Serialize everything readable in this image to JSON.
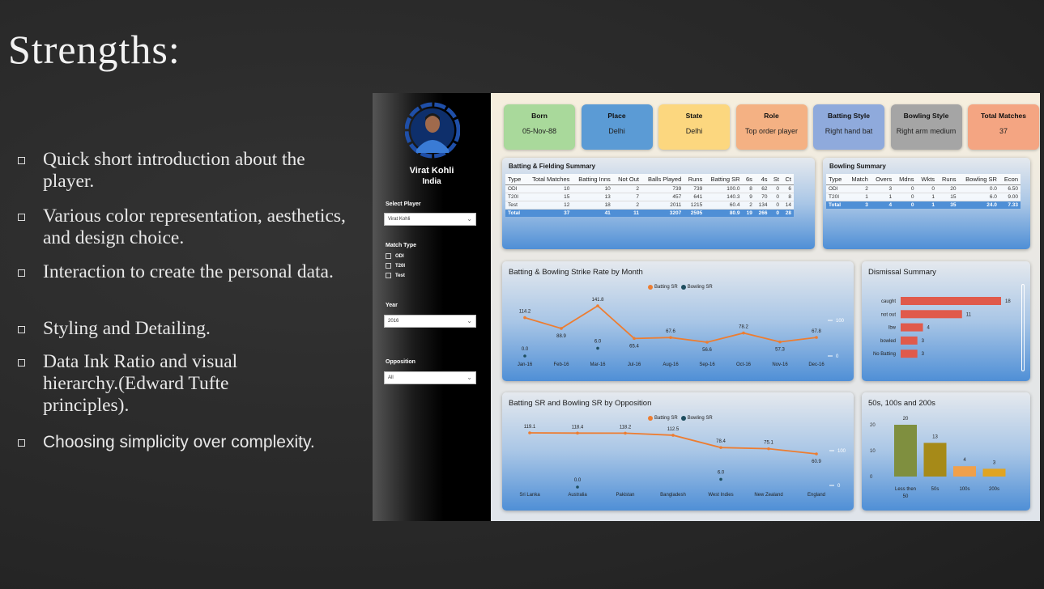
{
  "slide": {
    "title": "Strengths:",
    "bullets": [
      "Quick short introduction about the player.",
      "Various color representation, aesthetics, and design choice.",
      "Interaction to create the personal data.",
      "Styling and Detailing.",
      "Data Ink Ratio and visual hierarchy.(Edward Tufte principles).",
      "Choosing simplicity over complexity."
    ]
  },
  "sidebar": {
    "player_name": "Virat Kohli",
    "country": "India",
    "select_player_label": "Select Player",
    "select_player_value": "Virat Kohli",
    "match_type_label": "Match Type",
    "match_types": [
      "ODI",
      "T20I",
      "Test"
    ],
    "year_label": "Year",
    "year_value": "2016",
    "opposition_label": "Opposition",
    "opposition_value": "All"
  },
  "cards": [
    {
      "title": "Born",
      "value": "05-Nov-88",
      "color": "#a9d99b"
    },
    {
      "title": "Place",
      "value": "Delhi",
      "color": "#5b9bd5"
    },
    {
      "title": "State",
      "value": "Delhi",
      "color": "#fcd77f"
    },
    {
      "title": "Role",
      "value": "Top order player",
      "color": "#f4b183"
    },
    {
      "title": "Batting Style",
      "value": "Right hand bat",
      "color": "#8faadc"
    },
    {
      "title": "Bowling Style",
      "value": "Right arm medium",
      "color": "#a5a5a5"
    },
    {
      "title": "Total Matches",
      "value": "37",
      "color": "#f4a582"
    }
  ],
  "batting_summary": {
    "title": "Batting & Fielding Summary",
    "headers": [
      "Type",
      "Total Matches",
      "Batting Inns",
      "Not Out",
      "Balls Played",
      "Runs",
      "Batting SR",
      "6s",
      "4s",
      "St",
      "Ct"
    ],
    "rows": [
      [
        "ODI",
        "10",
        "10",
        "2",
        "739",
        "739",
        "100.0",
        "8",
        "62",
        "0",
        "6"
      ],
      [
        "T20I",
        "15",
        "13",
        "7",
        "457",
        "641",
        "140.3",
        "9",
        "70",
        "0",
        "8"
      ],
      [
        "Test",
        "12",
        "18",
        "2",
        "2011",
        "1215",
        "60.4",
        "2",
        "134",
        "0",
        "14"
      ]
    ],
    "total": [
      "Total",
      "37",
      "41",
      "11",
      "3207",
      "2595",
      "80.9",
      "19",
      "266",
      "0",
      "28"
    ]
  },
  "bowling_summary": {
    "title": "Bowling Summary",
    "headers": [
      "Type",
      "Match",
      "Overs",
      "Mdns",
      "Wkts",
      "Runs",
      "Bowling SR",
      "Econ"
    ],
    "rows": [
      [
        "ODI",
        "2",
        "3",
        "0",
        "0",
        "20",
        "0.0",
        "6.50"
      ],
      [
        "T20I",
        "1",
        "1",
        "0",
        "1",
        "15",
        "6.0",
        "9.00"
      ]
    ],
    "total": [
      "Total",
      "3",
      "4",
      "0",
      "1",
      "35",
      "24.0",
      "7.33"
    ]
  },
  "legend": {
    "batting": "Batting SR",
    "bowling": "Bowling SR",
    "batting_color": "#ed7d31",
    "bowling_color": "#1f4e5f"
  },
  "chart_data": [
    {
      "type": "line",
      "title": "Batting & Bowling Strike Rate by Month",
      "categories": [
        "Jan-16",
        "Feb-16",
        "Mar-16",
        "Jul-16",
        "Aug-16",
        "Sep-16",
        "Oct-16",
        "Nov-16",
        "Dec-16"
      ],
      "series": [
        {
          "name": "Batting SR",
          "values": [
            114.2,
            88.9,
            141.8,
            65.4,
            67.6,
            56.6,
            78.2,
            57.3,
            67.8
          ]
        },
        {
          "name": "Bowling SR",
          "values": [
            0.0,
            null,
            6.0,
            null,
            null,
            null,
            null,
            null,
            null
          ]
        }
      ],
      "secondary_ticks": [
        "100",
        "0"
      ]
    },
    {
      "type": "bar",
      "title": "Dismissal Summary",
      "categories": [
        "caught",
        "not out",
        "lbw",
        "bowled",
        "No Batting"
      ],
      "values": [
        18,
        11,
        4,
        3,
        3
      ]
    },
    {
      "type": "line",
      "title": "Batting SR and Bowling SR by Opposition",
      "categories": [
        "Sri Lanka",
        "Australia",
        "Pakistan",
        "Bangladesh",
        "West Indies",
        "New Zealand",
        "England"
      ],
      "series": [
        {
          "name": "Batting SR",
          "values": [
            119.1,
            118.4,
            118.2,
            112.5,
            78.4,
            75.1,
            60.9
          ]
        },
        {
          "name": "Bowling SR",
          "values": [
            null,
            0.0,
            null,
            null,
            6.0,
            null,
            null
          ]
        }
      ],
      "secondary_ticks": [
        "100",
        "0"
      ]
    },
    {
      "type": "bar",
      "title": "50s, 100s and 200s",
      "categories": [
        "Less then 50",
        "50s",
        "100s",
        "200s"
      ],
      "values": [
        20,
        13,
        4,
        3
      ],
      "yticks": [
        "20",
        "10",
        "0"
      ],
      "colors": [
        "#7f8f3f",
        "#a68a18",
        "#f0a04b",
        "#e0a422"
      ]
    }
  ]
}
